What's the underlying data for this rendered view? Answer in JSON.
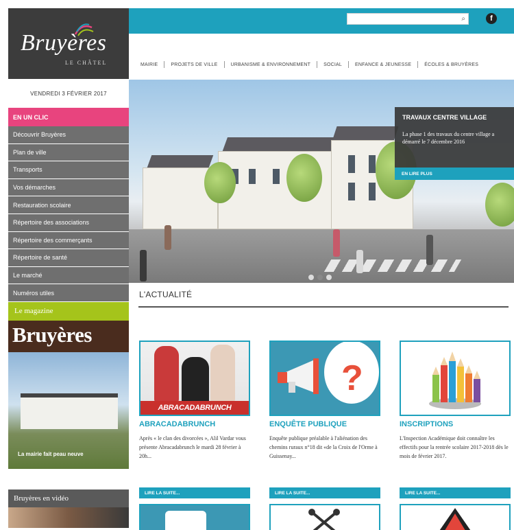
{
  "logo": {
    "name": "Bruyères",
    "subtitle": "LE CHÂTEL"
  },
  "header": {
    "search_placeholder": "",
    "facebook_label": "f"
  },
  "nav": {
    "items": [
      "MAIRIE",
      "PROJETS DE VILLE",
      "URBANISME & ENVIRONNEMENT",
      "SOCIAL",
      "ENFANCE & JEUNESSE",
      "ÉCOLES & BRUYÈRES"
    ]
  },
  "sidebar": {
    "date": "VENDREDI 3 FÉVRIER 2017",
    "clic_heading": "EN UN CLIC",
    "items": [
      {
        "label": "Découvrir Bruyères"
      },
      {
        "label": "Plan de ville"
      },
      {
        "label": "Transports"
      },
      {
        "label": "Vos démarches"
      },
      {
        "label": "Restauration scolaire"
      },
      {
        "label": "Répertoire des associations"
      },
      {
        "label": "Répertoire des commerçants"
      },
      {
        "label": "Répertoire de santé"
      },
      {
        "label": "Le marché"
      },
      {
        "label": "Numéros utiles"
      }
    ],
    "magazine_heading": "Le magazine",
    "magazine_title": "Bruyères",
    "magazine_caption": "La mairie fait peau neuve",
    "video_heading": "Bruyères en vidéo"
  },
  "hero": {
    "title": "TRAVAUX CENTRE VILLAGE",
    "text": "La phase 1 des travaux du centre village a démarré le 7 décembre 2016",
    "button": "EN LIRE PLUS",
    "slides": 3,
    "active_slide": 2
  },
  "news": {
    "heading": "L'ACTUALITÉ",
    "read_more": "LIRE LA SUITE...",
    "cards": [
      {
        "title": "ABRACADABRUNCH",
        "image_label": "ABRACADABRUNCH",
        "text": "Après « le clan des divorcées », Alil Vardar vous présente Abracadabrunch le mardi 28 février à 20h..."
      },
      {
        "title": "ENQUÊTE PUBLIQUE",
        "image_label": "",
        "text": "Enquête publique préalable à l'aliénation des chemins ruraux n°18 dit «de la Croix de l'Orme à Guissenay..."
      },
      {
        "title": "INSCRIPTIONS",
        "image_label": "",
        "text": "L'Inspection Académique doit connaître les effectifs pour la rentrée scolaire 2017-2018 dès le mois de février 2017."
      }
    ]
  },
  "colors": {
    "accent": "#1ea1bd",
    "pink": "#e8447e",
    "green": "#a5c41b",
    "menu_gray": "#6f6f6f",
    "dark": "#3c3c3c"
  }
}
